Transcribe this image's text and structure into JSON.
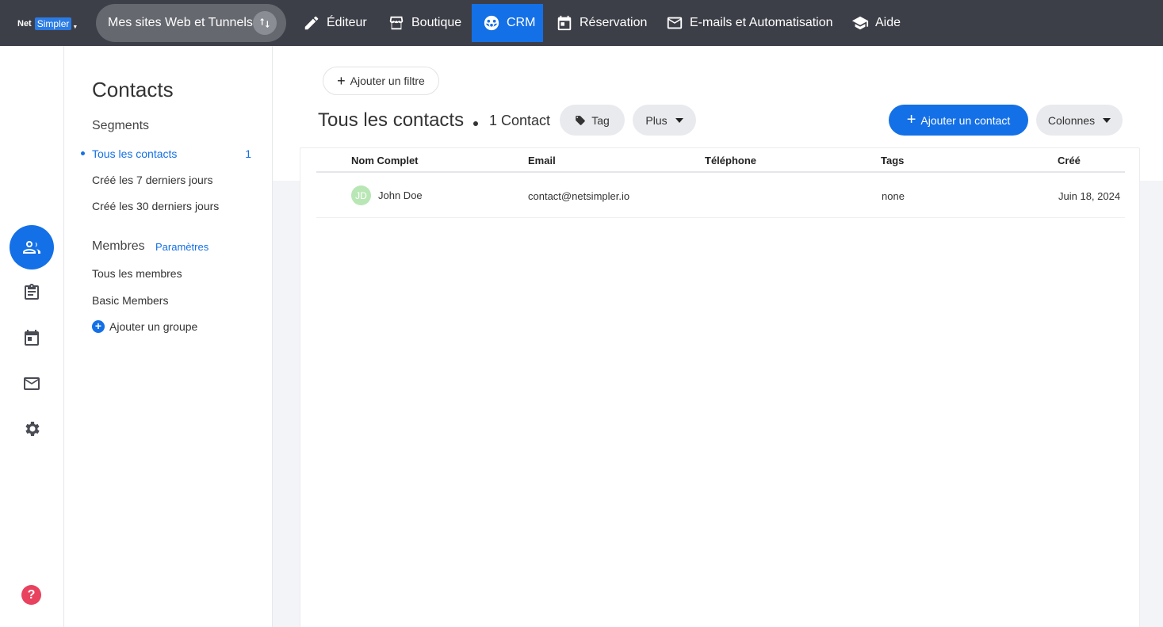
{
  "brand": {
    "part1": "Net",
    "part2": "Simpler"
  },
  "site_switcher": {
    "label": "Mes sites Web et Tunnels"
  },
  "nav": [
    {
      "label": "Éditeur",
      "icon": "pencil-icon"
    },
    {
      "label": "Boutique",
      "icon": "store-icon"
    },
    {
      "label": "CRM",
      "icon": "contacts-wheel-icon",
      "active": true
    },
    {
      "label": "Réservation",
      "icon": "calendar-icon"
    },
    {
      "label": "E-mails et Automatisation",
      "icon": "mail-icon"
    },
    {
      "label": "Aide",
      "icon": "graduation-cap-icon"
    }
  ],
  "rail": [
    "contacts-icon",
    "clipboard-icon",
    "calendar-icon",
    "mail-icon",
    "gear-icon",
    "help-icon"
  ],
  "help_label": "?",
  "sidebar": {
    "title": "Contacts",
    "segments_title": "Segments",
    "segments": [
      {
        "label": "Tous les contacts",
        "count": "1",
        "active": true
      },
      {
        "label": "Créé les 7 derniers jours"
      },
      {
        "label": "Créé les 30 derniers jours"
      }
    ],
    "members_title": "Membres",
    "members_settings": "Paramètres",
    "members": [
      {
        "label": "Tous les membres"
      },
      {
        "label": "Basic Members"
      }
    ],
    "add_group": "Ajouter un groupe"
  },
  "main": {
    "add_filter": "Ajouter un filtre",
    "title": "Tous les contacts",
    "count": "1 Contact",
    "tag_label": "Tag",
    "more_label": "Plus",
    "add_contact": "Ajouter un contact",
    "columns_label": "Colonnes"
  },
  "table": {
    "headers": [
      "Nom Complet",
      "Email",
      "Téléphone",
      "Tags",
      "Créé"
    ],
    "rows": [
      {
        "initials": "JD",
        "name": "John Doe",
        "email": "contact@netsimpler.io",
        "phone": "",
        "tags": "none",
        "created": "Juin 18, 2024"
      }
    ]
  },
  "colors": {
    "nav_bg": "#3d3f48",
    "accent": "#1470e6",
    "avatar": "#b9e6b5",
    "help": "#e8425e"
  }
}
